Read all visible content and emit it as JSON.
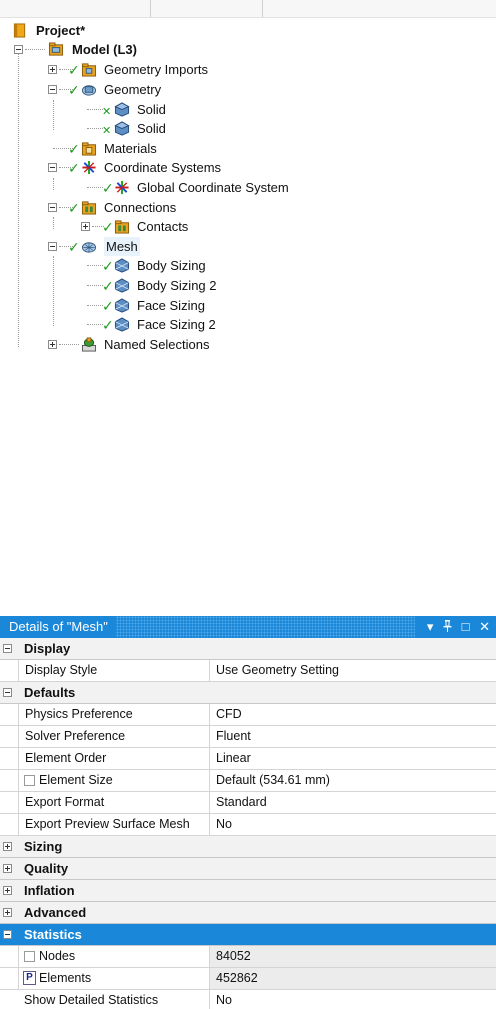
{
  "tree": {
    "project_label": "Project*",
    "model_label": "Model (L3)",
    "items": [
      {
        "label": "Geometry Imports"
      },
      {
        "label": "Geometry"
      },
      {
        "label": "Solid"
      },
      {
        "label": "Solid"
      },
      {
        "label": "Materials"
      },
      {
        "label": "Coordinate Systems"
      },
      {
        "label": "Global Coordinate System"
      },
      {
        "label": "Connections"
      },
      {
        "label": "Contacts"
      },
      {
        "label": "Mesh"
      },
      {
        "label": "Body Sizing"
      },
      {
        "label": "Body Sizing 2"
      },
      {
        "label": "Face Sizing"
      },
      {
        "label": "Face Sizing 2"
      },
      {
        "label": "Named Selections"
      }
    ]
  },
  "details": {
    "title": "Details of \"Mesh\"",
    "buttons": {
      "pin": "▾",
      "autohide": "ᐁ",
      "restore": "□",
      "close": "✕"
    },
    "groups": {
      "display": "Display",
      "defaults": "Defaults",
      "sizing": "Sizing",
      "quality": "Quality",
      "inflation": "Inflation",
      "advanced": "Advanced",
      "statistics": "Statistics"
    },
    "rows": {
      "display_style": {
        "key": "Display Style",
        "value": "Use Geometry Setting"
      },
      "physics_preference": {
        "key": "Physics Preference",
        "value": "CFD"
      },
      "solver_preference": {
        "key": "Solver Preference",
        "value": "Fluent"
      },
      "element_order": {
        "key": "Element Order",
        "value": "Linear"
      },
      "element_size": {
        "key": "Element Size",
        "value": "Default (534.61 mm)"
      },
      "export_format": {
        "key": "Export Format",
        "value": "Standard"
      },
      "export_preview": {
        "key": "Export Preview Surface Mesh",
        "value": "No"
      },
      "nodes": {
        "key": "Nodes",
        "value": "84052"
      },
      "elements": {
        "key": "Elements",
        "value": "452862",
        "param": "P"
      },
      "show_detailed": {
        "key": "Show Detailed Statistics",
        "value": "No"
      }
    }
  },
  "colors": {
    "accent": "#1b87d8",
    "check": "#1d9a1d",
    "folder": "#e8a322"
  }
}
